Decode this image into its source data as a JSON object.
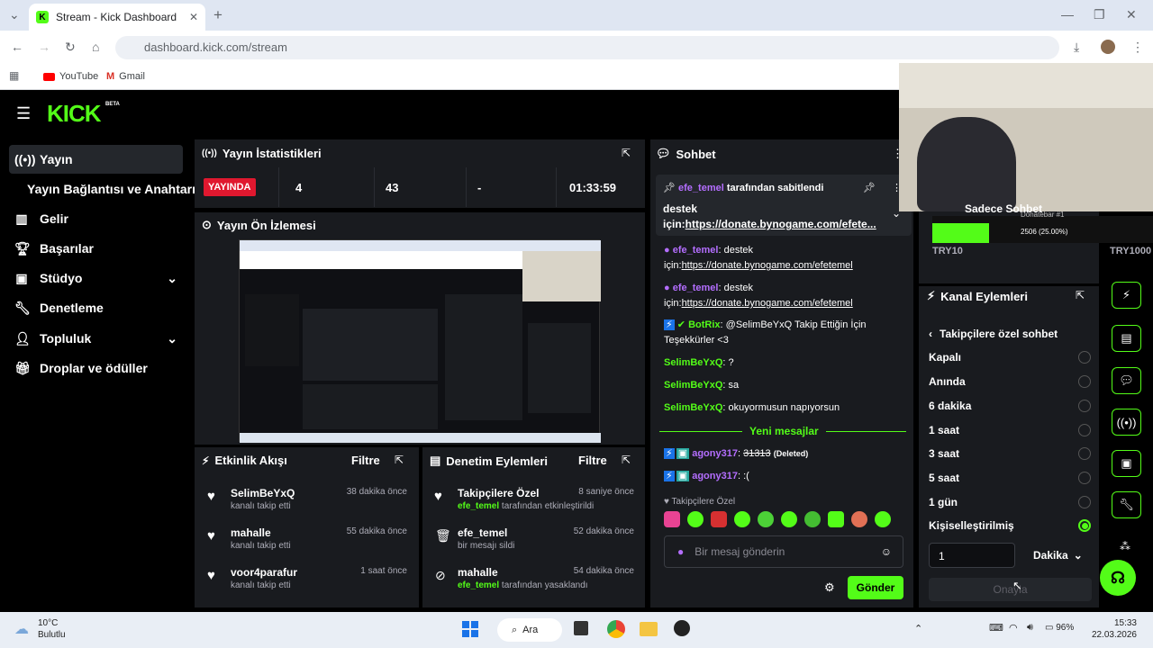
{
  "browser": {
    "tab_title": "Stream - Kick Dashboard",
    "url": "dashboard.kick.com/stream",
    "bookmarks": [
      "YouTube",
      "Gmail"
    ]
  },
  "app": {
    "logo": "KICK",
    "beta": "BETA"
  },
  "nav": [
    {
      "label": "Yayın",
      "icon": "broadcast-icon"
    },
    {
      "label": "Yayın Bağlantısı ve Anahtarı",
      "icon": ""
    },
    {
      "label": "Gelir",
      "icon": "chart-icon"
    },
    {
      "label": "Başarılar",
      "icon": "trophy-icon"
    },
    {
      "label": "Stüdyo",
      "icon": "studio-icon"
    },
    {
      "label": "Denetleme",
      "icon": "wrench-icon"
    },
    {
      "label": "Topluluk",
      "icon": "people-icon"
    },
    {
      "label": "Droplar ve ödüller",
      "icon": "gift-icon"
    }
  ],
  "stats": {
    "title": "Yayın İstatistikleri",
    "live": "YAYINDA",
    "viewers": "4",
    "followers": "43",
    "subs": "-",
    "uptime": "01:33:59"
  },
  "preview": {
    "title": "Yayın Ön İzlemesi"
  },
  "activity": {
    "title": "Etkinlik Akışı",
    "filter": "Filtre",
    "items": [
      {
        "name": "SelimBeYxQ",
        "sub": "kanalı takip etti",
        "time": "38 dakika önce"
      },
      {
        "name": "mahalle",
        "sub": "kanalı takip etti",
        "time": "55 dakika önce"
      },
      {
        "name": "voor4parafur",
        "sub": "kanalı takip etti",
        "time": "1 saat önce"
      }
    ]
  },
  "modlog": {
    "title": "Denetim Eylemleri",
    "filter": "Filtre",
    "items": [
      {
        "name": "Takipçilere Özel",
        "user": "efe_temel",
        "sub": " tarafından etkinleştirildi",
        "time": "8 saniye önce"
      },
      {
        "name": "efe_temel",
        "user": "",
        "sub": "bir mesajı sildi",
        "time": "52 dakika önce"
      },
      {
        "name": "mahalle",
        "user": "efe_temel",
        "sub": " tarafından yasaklandı",
        "time": "54 dakika önce"
      }
    ]
  },
  "chat": {
    "title": "Sohbet",
    "pinned_by": "efe_temel",
    "pinned_suffix": "tarafından sabitlendi",
    "pinned_text": "destek için:",
    "pinned_link": "https://donate.bynogame.com/efete...",
    "messages": [
      {
        "user": "efe_temel",
        "text": "destek için:",
        "link": "https://donate.bynogame.com/efetemel"
      },
      {
        "user": "efe_temel",
        "text": "destek için:",
        "link": "https://donate.bynogame.com/efetemel"
      },
      {
        "user": "BotRix",
        "text": "@SelimBeYxQ Takip Ettiğin İçin Teşekkürler <3",
        "link": ""
      },
      {
        "user": "SelimBeYxQ",
        "text": "?",
        "link": ""
      },
      {
        "user": "SelimBeYxQ",
        "text": "sa",
        "link": ""
      },
      {
        "user": "SelimBeYxQ",
        "text": "okuyormusun napıyorsun",
        "link": ""
      }
    ],
    "new_messages": "Yeni mesajlar",
    "after": [
      {
        "user": "agony317",
        "text": "31313",
        "note": "(Deleted)"
      },
      {
        "user": "agony317",
        "text": ":(",
        "note": ""
      }
    ],
    "mode": "Takipçilere Özel",
    "placeholder": "Bir mesaj gönderin",
    "send": "Gönder"
  },
  "overlay": {
    "chat_label": "Sadece Sohbet",
    "donor_label": "Donatebar #1",
    "progress_text": "2506 (25.00%)",
    "progress": 0.25,
    "currency": "TRY10",
    "currency2": "TRY1000"
  },
  "actions": {
    "title": "Kanal Eylemleri",
    "back_label": "Takipçilere özel sohbet",
    "options": [
      "Kapalı",
      "Anında",
      "6 dakika",
      "1 saat",
      "3 saat",
      "5 saat",
      "1 gün",
      "Kişiselleştirilmiş"
    ],
    "selected": "Kişiselleştirilmiş",
    "value": "1",
    "unit": "Dakika",
    "confirm": "Onayla"
  },
  "taskbar": {
    "temp": "10°C",
    "weather": "Bulutlu",
    "search": "Ara",
    "battery": "96%",
    "time": "15:33",
    "date": "22.03.2026"
  },
  "colors": {
    "accent": "#53fc18",
    "live": "#e0182f",
    "panel": "#191b1f"
  }
}
